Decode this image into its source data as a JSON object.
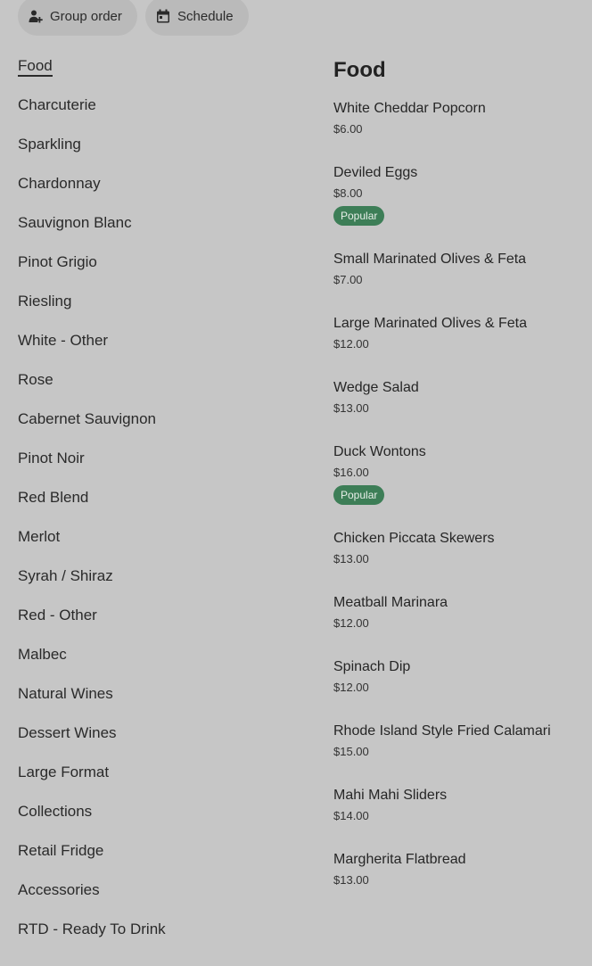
{
  "topbar": {
    "group_order_label": "Group order",
    "group_order_icon": "person-add-icon",
    "schedule_label": "Schedule",
    "schedule_icon": "calendar-icon"
  },
  "categories": [
    "Food",
    "Charcuterie",
    "Sparkling",
    "Chardonnay",
    "Sauvignon Blanc",
    "Pinot Grigio",
    "Riesling",
    "White - Other",
    "Rose",
    "Cabernet Sauvignon",
    "Pinot Noir",
    "Red Blend",
    "Merlot",
    "Syrah / Shiraz",
    "Red - Other",
    "Malbec",
    "Natural Wines",
    "Dessert Wines",
    "Large Format",
    "Collections",
    "Retail Fridge",
    "Accessories",
    "RTD - Ready To Drink"
  ],
  "active_category": "Food",
  "section": {
    "title": "Food",
    "items": [
      {
        "name": "White Cheddar Popcorn",
        "price": "$6.00",
        "badge": ""
      },
      {
        "name": "Deviled Eggs",
        "price": "$8.00",
        "badge": "Popular"
      },
      {
        "name": "Small Marinated Olives & Feta",
        "price": "$7.00",
        "badge": ""
      },
      {
        "name": "Large Marinated Olives & Feta",
        "price": "$12.00",
        "badge": ""
      },
      {
        "name": "Wedge Salad",
        "price": "$13.00",
        "badge": ""
      },
      {
        "name": "Duck Wontons",
        "price": "$16.00",
        "badge": "Popular"
      },
      {
        "name": "Chicken Piccata Skewers",
        "price": "$13.00",
        "badge": ""
      },
      {
        "name": "Meatball Marinara",
        "price": "$12.00",
        "badge": ""
      },
      {
        "name": "Spinach Dip",
        "price": "$12.00",
        "badge": ""
      },
      {
        "name": "Rhode Island Style Fried Calamari",
        "price": "$15.00",
        "badge": ""
      },
      {
        "name": "Mahi Mahi Sliders",
        "price": "$14.00",
        "badge": ""
      },
      {
        "name": "Margherita Flatbread",
        "price": "$13.00",
        "badge": ""
      }
    ]
  },
  "colors": {
    "background": "#c6c6c6",
    "pill": "#bababa",
    "popular_badge": "#3d7e57"
  }
}
